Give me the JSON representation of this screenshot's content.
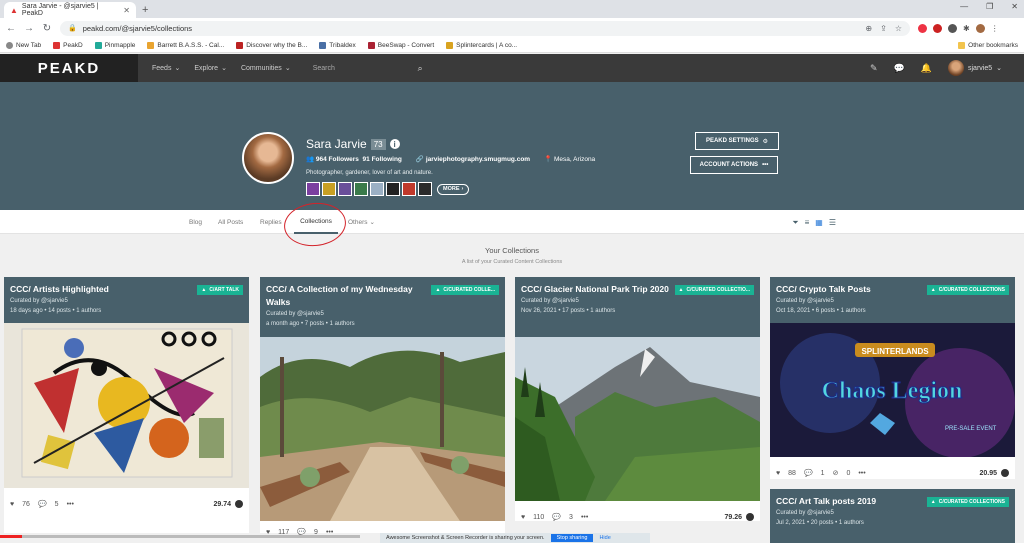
{
  "browser": {
    "tab_title": "Sara Jarvie - @sjarvie5 | PeakD",
    "url": "peakd.com/@sjarvie5/collections",
    "bookmarks": [
      "New Tab",
      "PeakD",
      "Pinmapple",
      "Barrett B.A.S.S. - Cal...",
      "Discover why the B...",
      "Tribaldex",
      "BeeSwap - Convert",
      "Splintercards | A co..."
    ],
    "other_bookmarks": "Other bookmarks"
  },
  "site": {
    "logo": "PEAKD",
    "nav": [
      "Feeds",
      "Explore",
      "Communities"
    ],
    "search_placeholder": "Search",
    "user": "sjarvie5"
  },
  "profile": {
    "name": "Sara Jarvie",
    "reputation": "73",
    "followers": "964 Followers",
    "following": "91 Following",
    "website": "jarviephotography.smugmug.com",
    "location": "Mesa, Arizona",
    "bio": "Photographer, gardener, lover of art and nature.",
    "more_label": "MORE",
    "settings_label": "PEAKD SETTINGS",
    "actions_label": "ACCOUNT ACTIONS"
  },
  "tabs": [
    "Blog",
    "All Posts",
    "Replies",
    "Collections",
    "Others"
  ],
  "collections": {
    "title": "Your Collections",
    "subtitle": "A list of your Curated Content Collections",
    "cards": [
      {
        "title": "CCC/ Artists Highlighted",
        "curator": "Curated by @sjarvie5",
        "meta": "18 days ago  •  14 posts  •  1 authors",
        "tag": "C/ART TALK",
        "votes": "76",
        "comments": "5",
        "payout": "29.74"
      },
      {
        "title": "CCC/ A Collection of my Wednesday Walks",
        "curator": "Curated by @sjarvie5",
        "meta": "a month ago  •  7 posts  •  1 authors",
        "tag": "C/CURATED COLLE...",
        "votes": "117",
        "comments": "9",
        "payout": ""
      },
      {
        "title": "CCC/ Glacier National Park Trip 2020",
        "curator": "Curated by @sjarvie5",
        "meta": "Nov 26, 2021  •  17 posts  •  1 authors",
        "tag": "C/CURATED COLLECTIO...",
        "votes": "110",
        "comments": "3",
        "payout": "79.26"
      },
      {
        "title": "CCC/ Crypto Talk Posts",
        "curator": "Curated by @sjarvie5",
        "meta": "Oct 18, 2021  •  6 posts  •  1 authors",
        "tag": "C/CURATED COLLECTIONS",
        "votes": "88",
        "comments": "1",
        "downvotes": "0",
        "payout": "20.95"
      },
      {
        "title": "CCC/ Art Talk posts 2019",
        "curator": "Curated by @sjarvie5",
        "meta": "Jul 2, 2021  •  20 posts  •  1 authors",
        "tag": "C/CURATED COLLECTIONS"
      }
    ]
  },
  "banner_art": {
    "splinterlands": "SPLINTERLANDS",
    "chaos": "Chaos Legion",
    "presale": "PRE-SALE EVENT"
  },
  "notification": {
    "text": "Awesome Screenshot & Screen Recorder is sharing your screen.",
    "stop": "Stop sharing",
    "hide": "Hide"
  }
}
